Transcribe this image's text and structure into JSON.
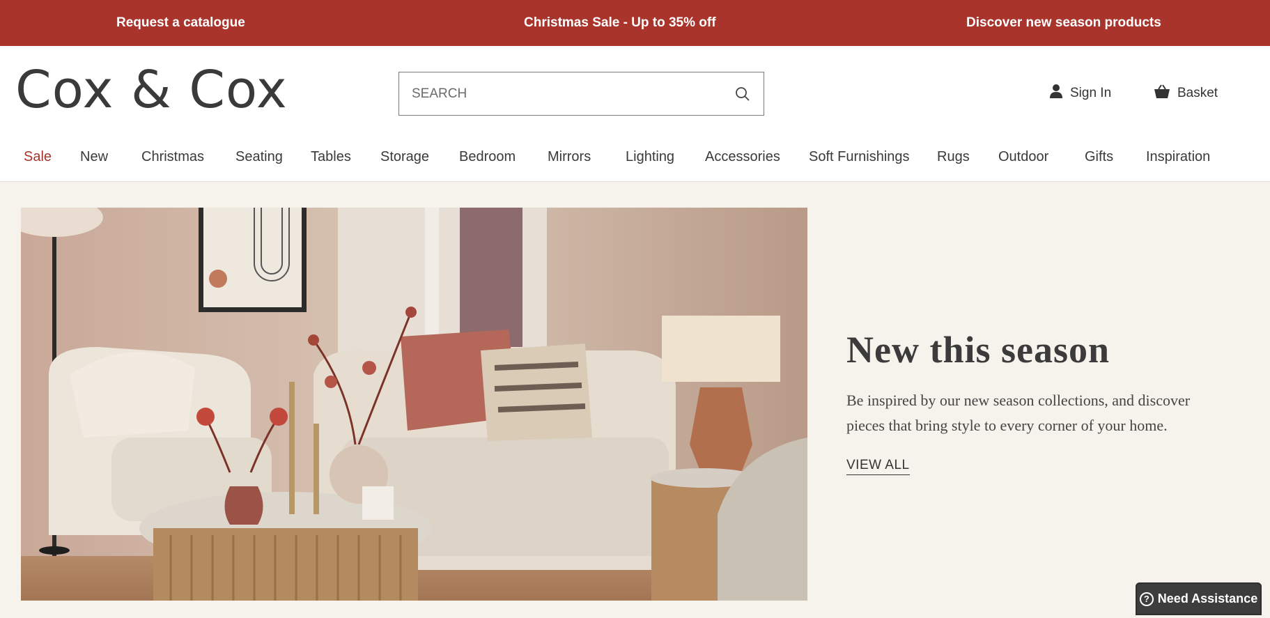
{
  "promo": {
    "left": "Request a catalogue",
    "center": "Christmas Sale - Up to 35% off",
    "right": "Discover new season products"
  },
  "header": {
    "logo": "Cox & Cox",
    "search_placeholder": "SEARCH",
    "sign_in": "Sign In",
    "basket": "Basket"
  },
  "nav": [
    "Sale",
    "New",
    "Christmas",
    "Seating",
    "Tables",
    "Storage",
    "Bedroom",
    "Mirrors",
    "Lighting",
    "Accessories",
    "Soft Furnishings",
    "Rugs",
    "Outdoor",
    "Gifts",
    "Inspiration"
  ],
  "hero": {
    "title": "New this season",
    "description": "Be inspired by our new season collections, and discover pieces that bring style to every corner of your home.",
    "link": "VIEW ALL"
  },
  "assist": {
    "label": "Need Assistance"
  },
  "colors": {
    "brand_red": "#a8342c",
    "background_cream": "#f6f2ec",
    "text_dark": "#3a3a3a"
  },
  "icons": [
    "search-icon",
    "user-icon",
    "basket-icon",
    "help-icon"
  ]
}
